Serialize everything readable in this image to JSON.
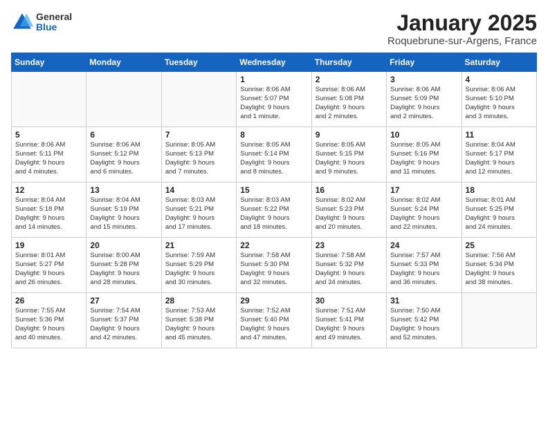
{
  "logo": {
    "general": "General",
    "blue": "Blue"
  },
  "title": "January 2025",
  "location": "Roquebrune-sur-Argens, France",
  "weekdays": [
    "Sunday",
    "Monday",
    "Tuesday",
    "Wednesday",
    "Thursday",
    "Friday",
    "Saturday"
  ],
  "weeks": [
    [
      {
        "day": "",
        "info": ""
      },
      {
        "day": "",
        "info": ""
      },
      {
        "day": "",
        "info": ""
      },
      {
        "day": "1",
        "info": "Sunrise: 8:06 AM\nSunset: 5:07 PM\nDaylight: 9 hours\nand 1 minute."
      },
      {
        "day": "2",
        "info": "Sunrise: 8:06 AM\nSunset: 5:08 PM\nDaylight: 9 hours\nand 2 minutes."
      },
      {
        "day": "3",
        "info": "Sunrise: 8:06 AM\nSunset: 5:09 PM\nDaylight: 9 hours\nand 2 minutes."
      },
      {
        "day": "4",
        "info": "Sunrise: 8:06 AM\nSunset: 5:10 PM\nDaylight: 9 hours\nand 3 minutes."
      }
    ],
    [
      {
        "day": "5",
        "info": "Sunrise: 8:06 AM\nSunset: 5:11 PM\nDaylight: 9 hours\nand 4 minutes."
      },
      {
        "day": "6",
        "info": "Sunrise: 8:06 AM\nSunset: 5:12 PM\nDaylight: 9 hours\nand 6 minutes."
      },
      {
        "day": "7",
        "info": "Sunrise: 8:05 AM\nSunset: 5:13 PM\nDaylight: 9 hours\nand 7 minutes."
      },
      {
        "day": "8",
        "info": "Sunrise: 8:05 AM\nSunset: 5:14 PM\nDaylight: 9 hours\nand 8 minutes."
      },
      {
        "day": "9",
        "info": "Sunrise: 8:05 AM\nSunset: 5:15 PM\nDaylight: 9 hours\nand 9 minutes."
      },
      {
        "day": "10",
        "info": "Sunrise: 8:05 AM\nSunset: 5:16 PM\nDaylight: 9 hours\nand 11 minutes."
      },
      {
        "day": "11",
        "info": "Sunrise: 8:04 AM\nSunset: 5:17 PM\nDaylight: 9 hours\nand 12 minutes."
      }
    ],
    [
      {
        "day": "12",
        "info": "Sunrise: 8:04 AM\nSunset: 5:18 PM\nDaylight: 9 hours\nand 14 minutes."
      },
      {
        "day": "13",
        "info": "Sunrise: 8:04 AM\nSunset: 5:19 PM\nDaylight: 9 hours\nand 15 minutes."
      },
      {
        "day": "14",
        "info": "Sunrise: 8:03 AM\nSunset: 5:21 PM\nDaylight: 9 hours\nand 17 minutes."
      },
      {
        "day": "15",
        "info": "Sunrise: 8:03 AM\nSunset: 5:22 PM\nDaylight: 9 hours\nand 18 minutes."
      },
      {
        "day": "16",
        "info": "Sunrise: 8:02 AM\nSunset: 5:23 PM\nDaylight: 9 hours\nand 20 minutes."
      },
      {
        "day": "17",
        "info": "Sunrise: 8:02 AM\nSunset: 5:24 PM\nDaylight: 9 hours\nand 22 minutes."
      },
      {
        "day": "18",
        "info": "Sunrise: 8:01 AM\nSunset: 5:25 PM\nDaylight: 9 hours\nand 24 minutes."
      }
    ],
    [
      {
        "day": "19",
        "info": "Sunrise: 8:01 AM\nSunset: 5:27 PM\nDaylight: 9 hours\nand 26 minutes."
      },
      {
        "day": "20",
        "info": "Sunrise: 8:00 AM\nSunset: 5:28 PM\nDaylight: 9 hours\nand 28 minutes."
      },
      {
        "day": "21",
        "info": "Sunrise: 7:59 AM\nSunset: 5:29 PM\nDaylight: 9 hours\nand 30 minutes."
      },
      {
        "day": "22",
        "info": "Sunrise: 7:58 AM\nSunset: 5:30 PM\nDaylight: 9 hours\nand 32 minutes."
      },
      {
        "day": "23",
        "info": "Sunrise: 7:58 AM\nSunset: 5:32 PM\nDaylight: 9 hours\nand 34 minutes."
      },
      {
        "day": "24",
        "info": "Sunrise: 7:57 AM\nSunset: 5:33 PM\nDaylight: 9 hours\nand 36 minutes."
      },
      {
        "day": "25",
        "info": "Sunrise: 7:56 AM\nSunset: 5:34 PM\nDaylight: 9 hours\nand 38 minutes."
      }
    ],
    [
      {
        "day": "26",
        "info": "Sunrise: 7:55 AM\nSunset: 5:36 PM\nDaylight: 9 hours\nand 40 minutes."
      },
      {
        "day": "27",
        "info": "Sunrise: 7:54 AM\nSunset: 5:37 PM\nDaylight: 9 hours\nand 42 minutes."
      },
      {
        "day": "28",
        "info": "Sunrise: 7:53 AM\nSunset: 5:38 PM\nDaylight: 9 hours\nand 45 minutes."
      },
      {
        "day": "29",
        "info": "Sunrise: 7:52 AM\nSunset: 5:40 PM\nDaylight: 9 hours\nand 47 minutes."
      },
      {
        "day": "30",
        "info": "Sunrise: 7:51 AM\nSunset: 5:41 PM\nDaylight: 9 hours\nand 49 minutes."
      },
      {
        "day": "31",
        "info": "Sunrise: 7:50 AM\nSunset: 5:42 PM\nDaylight: 9 hours\nand 52 minutes."
      },
      {
        "day": "",
        "info": ""
      }
    ]
  ]
}
